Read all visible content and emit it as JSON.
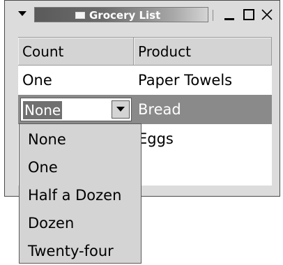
{
  "window": {
    "title": "Grocery List",
    "icons": {
      "menu": "triangle-down-icon",
      "app": "window-icon",
      "minimize": "minimize-icon",
      "maximize": "maximize-icon",
      "close": "close-icon"
    }
  },
  "table": {
    "columns": [
      "Count",
      "Product"
    ],
    "rows": [
      {
        "count": "One",
        "product": "Paper Towels"
      },
      {
        "count": "None",
        "product": "Bread"
      },
      {
        "count": "",
        "product": "Eggs"
      }
    ],
    "selected_row": 1
  },
  "combo": {
    "value": "None",
    "options": [
      "None",
      "One",
      "Half a Dozen",
      "Dozen",
      "Twenty-four"
    ]
  },
  "colors": {
    "title_gradient_start": "#5a5a5a",
    "selection": "#8a8a8a",
    "surface": "#d4d4d4"
  }
}
